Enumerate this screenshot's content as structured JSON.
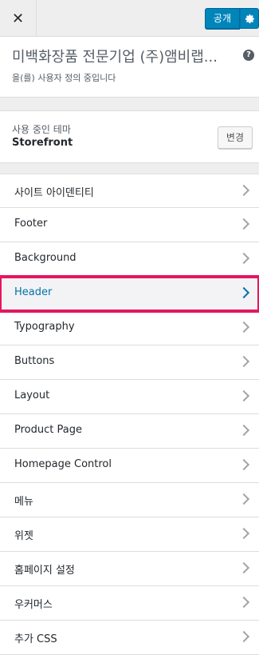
{
  "header": {
    "close_icon": "✕",
    "publish_label": "공개",
    "settings_icon": "⚙"
  },
  "site": {
    "title": "미백화장품 전문기업 (주)앰비랩...",
    "subtitle": "을(를) 사용자 정의 중입니다",
    "help_icon": "?"
  },
  "theme": {
    "label": "사용 중인 테마",
    "name": "Storefront",
    "change_label": "변경"
  },
  "panels": [
    {
      "label": "사이트 아이덴티티"
    },
    {
      "label": "Footer"
    },
    {
      "label": "Background"
    },
    {
      "label": "Header"
    },
    {
      "label": "Typography"
    },
    {
      "label": "Buttons"
    },
    {
      "label": "Layout"
    },
    {
      "label": "Product Page"
    },
    {
      "label": "Homepage Control"
    },
    {
      "label": "메뉴"
    },
    {
      "label": "위젯"
    },
    {
      "label": "홈페이지 설정"
    },
    {
      "label": "우커머스"
    },
    {
      "label": "추가 CSS"
    }
  ],
  "colors": {
    "accent": "#0085ba",
    "highlight_border": "#e5165f",
    "highlight_text": "#0073aa"
  }
}
